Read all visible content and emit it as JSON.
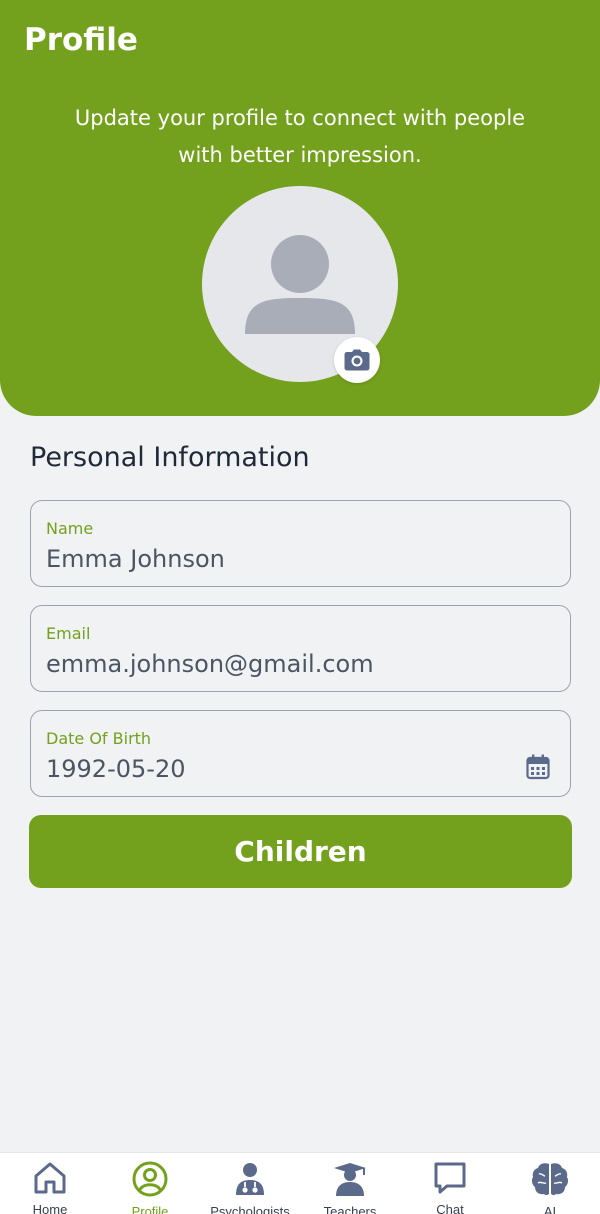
{
  "header": {
    "title": "Profile",
    "subtitle": "Update your profile to connect with people with better impression."
  },
  "icons": {
    "avatar": "user-placeholder-icon",
    "camera": "camera-icon",
    "calendar": "calendar-icon"
  },
  "section": {
    "title": "Personal Information"
  },
  "fields": [
    {
      "label": "Name",
      "value": "Emma Johnson"
    },
    {
      "label": "Email",
      "value": "emma.johnson@gmail.com"
    },
    {
      "label": "Date Of Birth",
      "value": "1992-05-20"
    }
  ],
  "children_button": {
    "label": "Children"
  },
  "tabbar": {
    "items": [
      {
        "label": "Home",
        "icon": "home-icon",
        "active": false
      },
      {
        "label": "Profile",
        "icon": "profile-icon",
        "active": true
      },
      {
        "label": "Psychologists",
        "icon": "doctor-icon",
        "active": false
      },
      {
        "label": "Teachers",
        "icon": "teacher-icon",
        "active": false
      },
      {
        "label": "Chat",
        "icon": "chat-icon",
        "active": false
      },
      {
        "label": "AI",
        "icon": "brain-icon",
        "active": false
      }
    ]
  },
  "colors": {
    "brand": "#74a11d",
    "background": "#f1f2f4",
    "icon": "#5b6a8a"
  }
}
